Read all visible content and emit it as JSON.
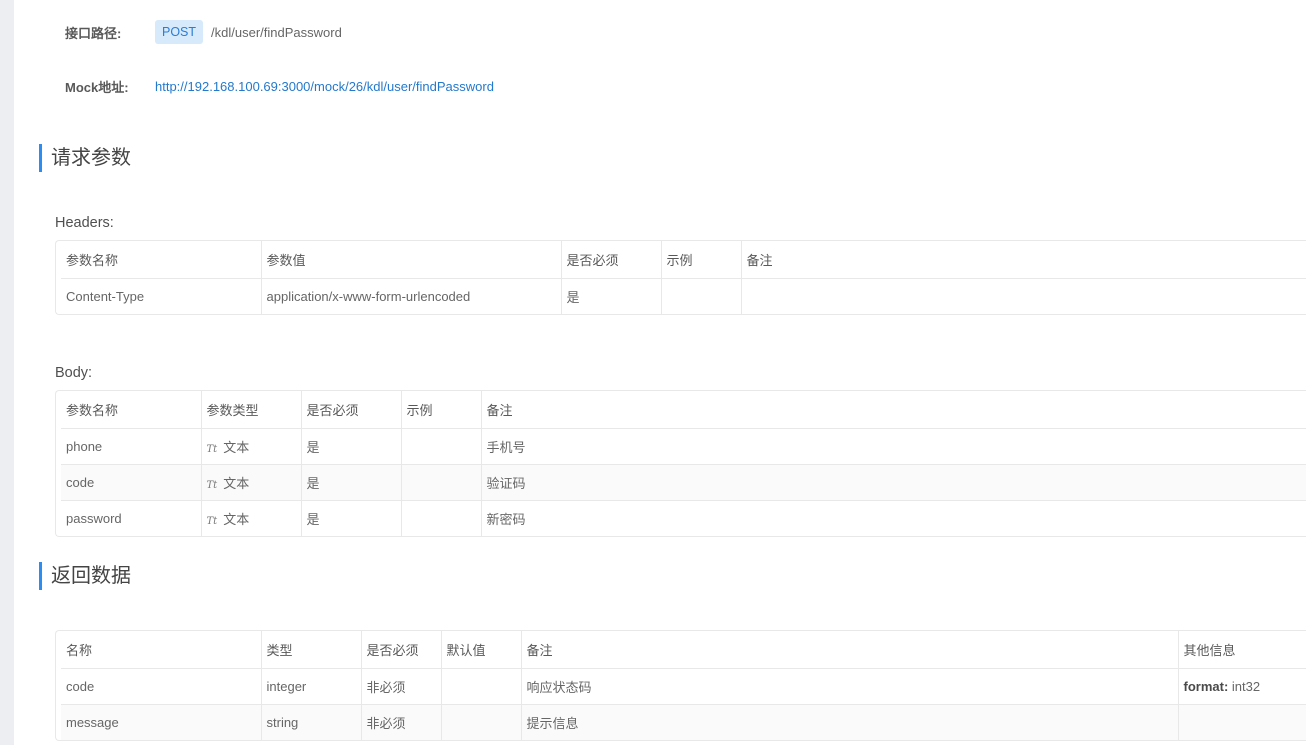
{
  "api": {
    "path_label": "接口路径:",
    "method": "POST",
    "path": "/kdl/user/findPassword",
    "mock_label": "Mock地址:",
    "mock_url": "http://192.168.100.69:3000/mock/26/kdl/user/findPassword"
  },
  "request": {
    "title": "请求参数",
    "headers_title": "Headers:",
    "headers_columns": [
      "参数名称",
      "参数值",
      "是否必须",
      "示例",
      "备注"
    ],
    "headers_rows": [
      [
        "Content-Type",
        "application/x-www-form-urlencoded",
        "是",
        "",
        ""
      ]
    ],
    "body_title": "Body:",
    "body_columns": [
      "参数名称",
      "参数类型",
      "是否必须",
      "示例",
      "备注"
    ],
    "body_rows": [
      [
        "phone",
        "文本",
        "是",
        "",
        "手机号"
      ],
      [
        "code",
        "文本",
        "是",
        "",
        "验证码"
      ],
      [
        "password",
        "文本",
        "是",
        "",
        "新密码"
      ]
    ],
    "type_icon": "Tt"
  },
  "response": {
    "title": "返回数据",
    "columns": [
      "名称",
      "类型",
      "是否必须",
      "默认值",
      "备注",
      "其他信息"
    ],
    "rows": [
      [
        "code",
        "integer",
        "非必须",
        "",
        "响应状态码",
        "format:",
        "int32"
      ],
      [
        "message",
        "string",
        "非必须",
        "",
        "提示信息",
        "",
        ""
      ]
    ]
  },
  "colors": {
    "accent": "#2d8cf0",
    "link": "#2479cc",
    "badge_bg": "#d6eafc"
  }
}
